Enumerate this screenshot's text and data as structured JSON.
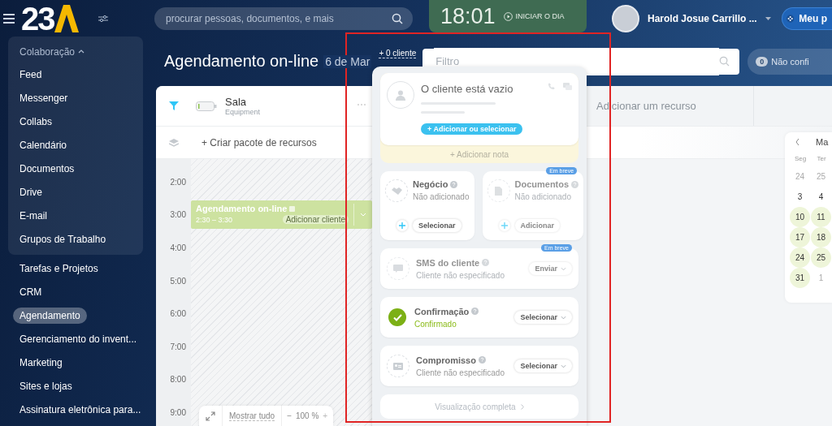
{
  "topbar": {
    "logo": "23",
    "search": {
      "placeholder": "procurar pessoas, documentos, e mais"
    },
    "clock": {
      "time": "18:01",
      "button": "INICIAR O DIA"
    },
    "user": {
      "name": "Harold Josue Carrillo ..."
    },
    "my_button": "Meu p"
  },
  "sidebar": {
    "group": {
      "label": "Colaboração",
      "expanded": true,
      "items": [
        {
          "label": "Feed",
          "selected": false
        },
        {
          "label": "Messenger",
          "selected": false
        },
        {
          "label": "Collabs",
          "selected": false
        },
        {
          "label": "Calendário",
          "selected": false
        },
        {
          "label": "Documentos",
          "selected": false
        },
        {
          "label": "Drive",
          "selected": false
        },
        {
          "label": "E-mail",
          "selected": false
        },
        {
          "label": "Grupos de Trabalho",
          "selected": false
        }
      ]
    },
    "items": [
      {
        "label": "Tarefas e Projetos",
        "selected": false
      },
      {
        "label": "CRM",
        "selected": false
      },
      {
        "label": "Agendamento",
        "selected": true
      },
      {
        "label": "Gerenciamento do invent...",
        "selected": false
      },
      {
        "label": "Marketing",
        "selected": false
      },
      {
        "label": "Sites e lojas",
        "selected": false
      },
      {
        "label": "Assinatura eletrônica para...",
        "selected": false
      }
    ]
  },
  "page": {
    "title": "Agendamento on-line",
    "date": "6 de Mar",
    "clients_link": "+ 0 cliente",
    "filter": {
      "placeholder": "Filtro"
    },
    "unconfirmed": {
      "count": "0",
      "label": "Não confi"
    }
  },
  "schedule": {
    "resource": {
      "name": "Sala",
      "type": "Equipment"
    },
    "create_bundle": "+ Criar pacote de recursos",
    "add_resource": "Adicionar um recurso",
    "hours": [
      "2:00",
      "3:00",
      "4:00",
      "5:00",
      "6:00",
      "7:00",
      "8:00",
      "9:00"
    ],
    "event": {
      "title": "Agendamento on-line",
      "time": "2:30 – 3:30",
      "client_button": "Adicionar cliente"
    },
    "footer": {
      "show_all": "Mostrar tudo",
      "minus": "−",
      "zoom": "100 %",
      "plus": "+"
    }
  },
  "mini_calendar": {
    "month": "Ma",
    "weekdays": [
      "Seg",
      "Ter"
    ],
    "weeks": [
      [
        {
          "day": "24",
          "muted": true,
          "highlighted": false
        },
        {
          "day": "25",
          "muted": true,
          "highlighted": false
        }
      ],
      [
        {
          "day": "3",
          "muted": false,
          "highlighted": false
        },
        {
          "day": "4",
          "muted": false,
          "highlighted": false
        }
      ],
      [
        {
          "day": "10",
          "muted": false,
          "highlighted": true
        },
        {
          "day": "11",
          "muted": false,
          "highlighted": true
        }
      ],
      [
        {
          "day": "17",
          "muted": false,
          "highlighted": true
        },
        {
          "day": "18",
          "muted": false,
          "highlighted": true
        }
      ],
      [
        {
          "day": "24",
          "muted": false,
          "highlighted": true
        },
        {
          "day": "25",
          "muted": false,
          "highlighted": true
        }
      ],
      [
        {
          "day": "31",
          "muted": false,
          "highlighted": true
        },
        {
          "day": "1",
          "muted": true,
          "highlighted": false
        }
      ]
    ]
  },
  "popup": {
    "client": {
      "title": "O cliente está vazio",
      "button": "+ Adicionar ou selecionar",
      "note": "+ Adicionar nota"
    },
    "cards": [
      {
        "kind": "deal",
        "title": "Negócio",
        "status": "Não adicionado",
        "button": "Selecionar",
        "disabled": false
      },
      {
        "kind": "document",
        "title": "Documentos",
        "status": "Não adicionado",
        "button": "Adicionar",
        "badge": "Em breve",
        "disabled": true
      }
    ],
    "rows": [
      {
        "kind": "sms",
        "title": "SMS do cliente",
        "status": "Cliente não especificado",
        "button": "Enviar",
        "badge": "Em breve",
        "disabled": true,
        "confirmed": false
      },
      {
        "kind": "confirmation",
        "title": "Confirmação",
        "status": "Confirmado",
        "button": "Selecionar",
        "disabled": false,
        "confirmed": true
      },
      {
        "kind": "appointment",
        "title": "Compromisso",
        "status": "Cliente não especificado",
        "button": "Selecionar",
        "disabled": false,
        "confirmed": false
      }
    ],
    "full_view": "Visualização completa"
  }
}
